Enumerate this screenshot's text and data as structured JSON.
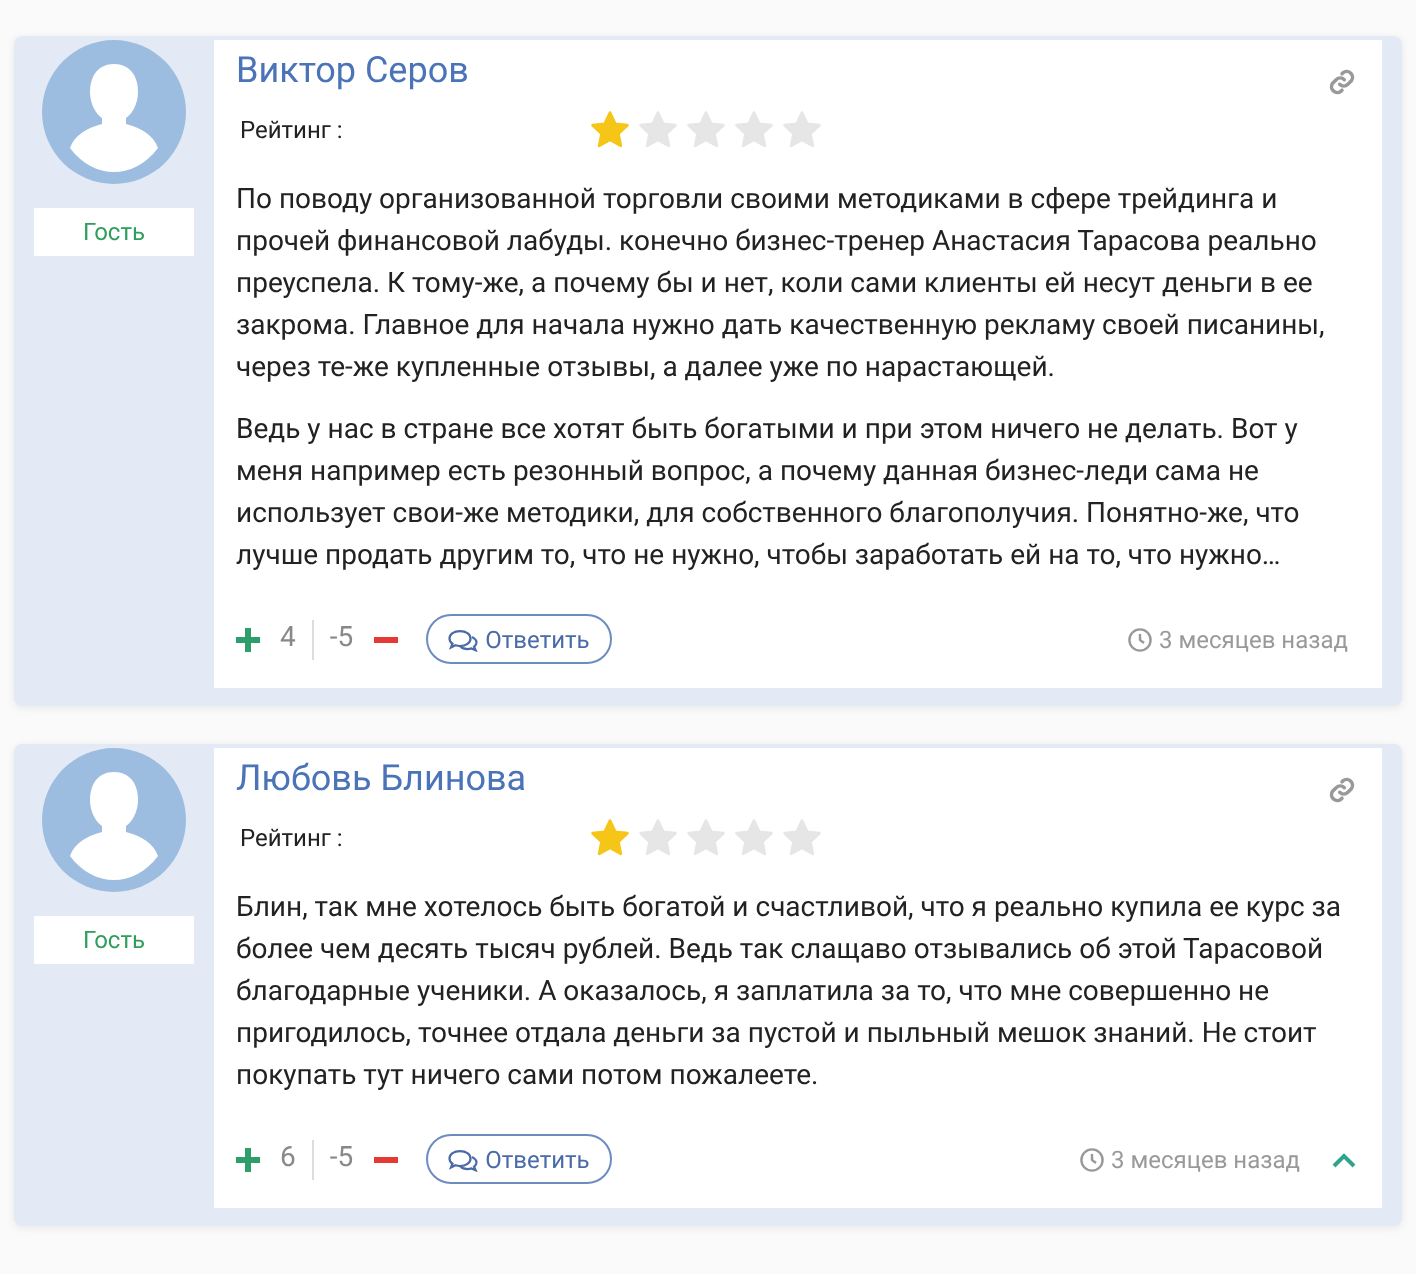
{
  "comments": [
    {
      "author": "Виктор Серов",
      "role": "Гость",
      "rating_label": "Рейтинг :",
      "stars": 1,
      "paragraphs": [
        "По поводу организованной торговли своими методиками в сфере трейдинга и прочей финансовой лабуды. конечно бизнес-тренер Анастасия Тарасова реально преуспела. К тому-же, а почему бы и нет, коли сами клиенты ей несут деньги в ее закрома. Главное для начала нужно дать качественную рекламу своей писанины, через те-же купленные отзывы, а далее уже по нарастающей.",
        "Ведь у нас в стране все хотят быть богатыми и при этом ничего не делать. Вот у меня например есть резонный вопрос, а почему данная бизнес-леди сама не использует свои-же методики, для собственного благополучия. Понятно-же, что лучше продать другим то, что не нужно, чтобы заработать ей на то, что нужно…"
      ],
      "likes": "4",
      "dislikes": "-5",
      "reply": "Ответить",
      "time": "3 месяцев назад",
      "back_to_top": false
    },
    {
      "author": "Любовь Блинова",
      "role": "Гость",
      "rating_label": "Рейтинг :",
      "stars": 1,
      "paragraphs": [
        "Блин, так мне хотелось быть богатой и счастливой, что я реально купила ее курс за более чем десять тысяч рублей. Ведь так слащаво отзывались об этой Тарасовой благодарные ученики. А оказалось, я заплатила за то, что мне совершенно не пригодилось, точнее отдала деньги за пустой и пыльный мешок знаний. Не стоит покупать тут ничего сами потом пожалеете."
      ],
      "likes": "6",
      "dislikes": "-5",
      "reply": "Ответить",
      "time": "3 месяцев назад",
      "back_to_top": true
    }
  ]
}
